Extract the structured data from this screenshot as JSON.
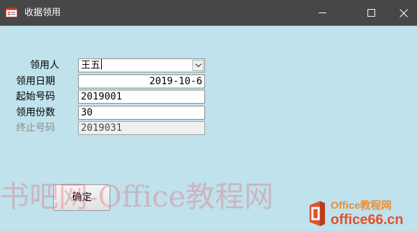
{
  "window": {
    "title": "收据领用",
    "icon": "form-icon",
    "controls": [
      "minimize-icon",
      "maximize-icon",
      "close-icon"
    ]
  },
  "form": {
    "recipient": {
      "label": "领用人",
      "value": "王五"
    },
    "date": {
      "label": "领用日期",
      "value": "2019-10-6"
    },
    "start_number": {
      "label": "起始号码",
      "value": "2019001"
    },
    "quantity": {
      "label": "领用份数",
      "value": "30"
    },
    "end_number": {
      "label": "终止号码",
      "value": "2019031"
    },
    "ok_button": "确定"
  },
  "watermark": {
    "text": "书吧网-Office教程网",
    "logo_top": "Office教程网",
    "logo_bottom": "office66.cn"
  },
  "colors": {
    "background": "#bfe2ec",
    "titlebar": "#474747",
    "watermark": "#de7887",
    "brand_orange": "#f28c2c",
    "brand_red": "#e2512a"
  }
}
